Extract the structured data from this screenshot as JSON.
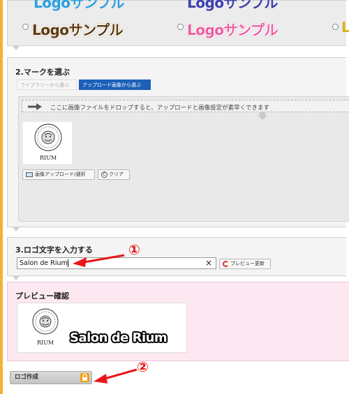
{
  "logo_samples": {
    "row_top": [
      "Logoサンプル",
      "Logoサンプル"
    ],
    "row_main": [
      "Logoサンプル",
      "Logoサンプル",
      "L"
    ]
  },
  "section2": {
    "title": "2.マークを選ぶ",
    "tabs": [
      {
        "label": "ライブラリーから選ぶ",
        "active": false
      },
      {
        "label": "アップロード画像から選ぶ",
        "active": true
      }
    ],
    "drop_hint": "ここに画像ファイルをドロップすると、アップロードと画像設定が素早くできます",
    "thumbnail_caption": "RIUM",
    "upload_button": "画像アップロード/選択",
    "clear_button": "クリア"
  },
  "section3": {
    "title": "3.ロゴ文字を入力する",
    "input_value": "Salon de Rium",
    "clear_icon": "×",
    "refresh_button": "プレビュー更新"
  },
  "preview": {
    "title": "プレビュー確認",
    "logo_text": "Salon de Rium",
    "mark_caption": "RIUM"
  },
  "create_button": "ロゴ作成",
  "annotations": [
    "①",
    "②"
  ],
  "colors": {
    "accent_blue": "#1c5fb8",
    "annotation_red": "#e8161b",
    "border_orange": "#f3b232",
    "preview_bg": "#fde8f1",
    "logo_brown": "#5a3a12",
    "logo_pink": "#ea5fa0"
  }
}
